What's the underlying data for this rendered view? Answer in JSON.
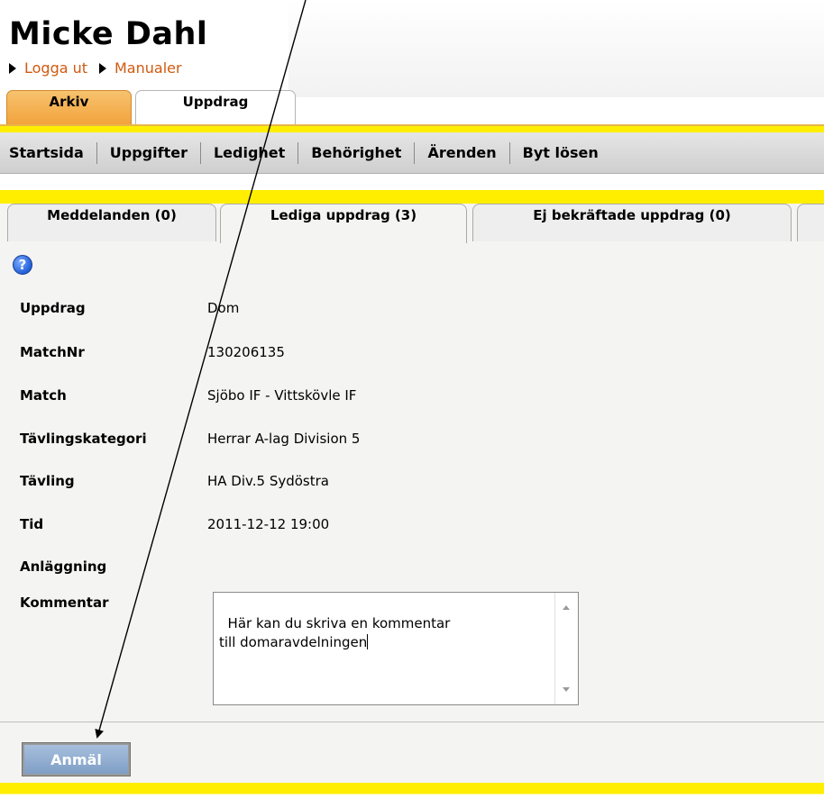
{
  "user": {
    "name": "Micke Dahl",
    "links": [
      "Logga ut",
      "Manualer"
    ]
  },
  "main_tabs": [
    {
      "label": "Arkiv",
      "active": true
    },
    {
      "label": "Uppdrag",
      "active": false
    }
  ],
  "menu": [
    "Startsida",
    "Uppgifter",
    "Ledighet",
    "Behörighet",
    "Ärenden",
    "Byt lösen"
  ],
  "sub_tabs": [
    {
      "label": "Meddelanden (0)",
      "active": false
    },
    {
      "label": "Lediga uppdrag (3)",
      "active": true
    },
    {
      "label": "Ej bekräftade uppdrag (0)",
      "active": false
    }
  ],
  "details": [
    {
      "label": "Uppdrag",
      "value": "Dom"
    },
    {
      "label": "MatchNr",
      "value": "130206135"
    },
    {
      "label": "Match",
      "value": "Sjöbo IF - Vittskövle IF"
    },
    {
      "label": "Tävlingskategori",
      "value": "Herrar A-lag Division 5"
    },
    {
      "label": "Tävling",
      "value": "HA Div.5 Sydöstra"
    },
    {
      "label": "Tid",
      "value": "2011-12-12 19:00"
    },
    {
      "label": "Anläggning",
      "value": ""
    }
  ],
  "comment": {
    "label": "Kommentar",
    "value": "Här kan du skriva en kommentar\ntill domaravdelningen"
  },
  "submit_label": "Anmäl",
  "icons": {
    "help": "help-icon",
    "bullet": "triangle-bullet-icon"
  },
  "colors": {
    "accent_yellow": "#ffee00",
    "link_orange": "#d05a10",
    "active_tab": "#f2a33c",
    "button_blue": "#8fabd0"
  }
}
